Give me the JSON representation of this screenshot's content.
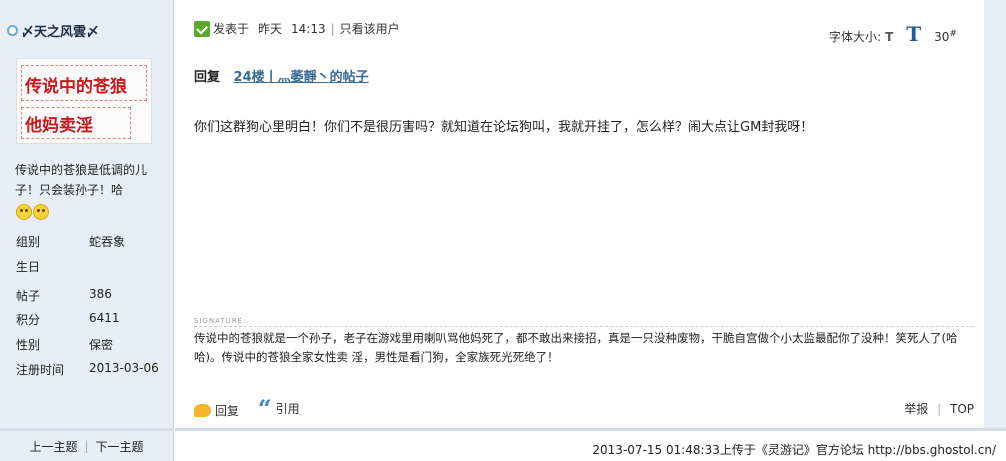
{
  "profile": {
    "username": "〆天之风雲〆",
    "avatar_lines": [
      "传说中的苍狼",
      "他妈卖淫"
    ],
    "bio": "传说中的苍狼是低调的儿子！只会装孙子！哈",
    "stats": [
      {
        "label": "组别",
        "value": "蛇吞象"
      },
      {
        "label": "生日",
        "value": ""
      },
      {
        "label": "帖子",
        "value": "386"
      },
      {
        "label": "积分",
        "value": "6411"
      },
      {
        "label": "性别",
        "value": "保密"
      },
      {
        "label": "注册时间",
        "value": "2013-03-06"
      }
    ]
  },
  "nav": {
    "prev_topic": "上一主题",
    "next_topic": "下一主题"
  },
  "post": {
    "posted_label": "发表于",
    "posted_time": "昨天",
    "posted_clock": "14:13",
    "only_author": "只看该用户",
    "font_size_label": "字体大小:",
    "font_small": "T",
    "font_large": "T",
    "floor": "30",
    "floor_mark": "#",
    "reply_label": "回复",
    "reply_link": "24楼丨灬萎靜丶的帖子",
    "body": "你们这群狗心里明白！你们不是很历害吗？就知道在论坛狗叫，我就开挂了，怎么样？闹大点让GM封我呀！",
    "signature_label": "SIGNATURE:",
    "signature": "传说中的苍狼就是一个孙子，老子在游戏里用喇叭骂他妈死了，都不敢出来接招，真是一只没种废物，干脆自宫做个小太监最配你了没种！笑死人了(哈哈)。传说中的苍狼全家女性卖 淫，男性是看门狗，全家族死光死绝了！",
    "actions": {
      "reply": "回复",
      "quote": "引用",
      "report": "举报",
      "top": "TOP"
    }
  },
  "footer": {
    "upload_info": "2013-07-15 01:48:33上传于《灵游记》官方论坛 http://bbs.ghostol.cn/"
  },
  "colors": {
    "sidebar_bg": "#e8eef7",
    "link": "#3a6a96",
    "accent": "#1f5e99"
  }
}
